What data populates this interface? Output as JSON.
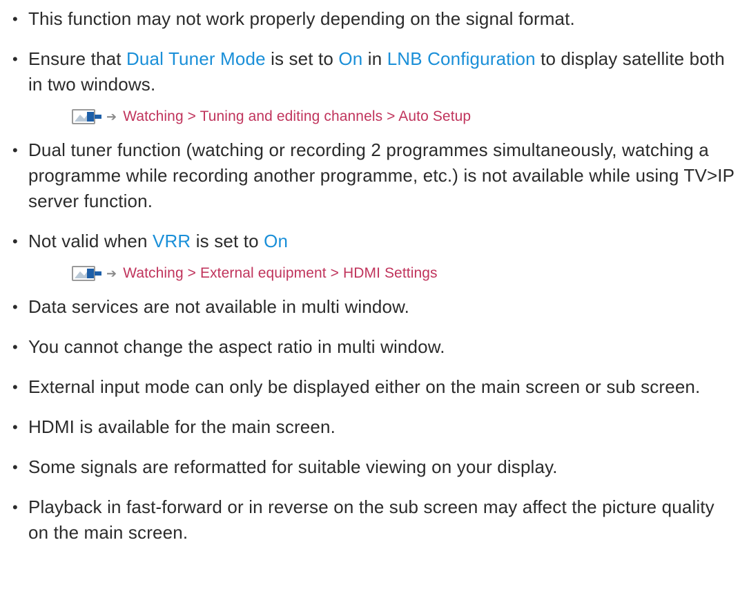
{
  "notes": [
    {
      "text": "This function may not work properly depending on the signal format."
    },
    {
      "parts": [
        "Ensure that ",
        "Dual Tuner Mode",
        " is set to ",
        "On",
        " in ",
        "LNB Configuration",
        " to display satellite both in two windows."
      ]
    },
    {
      "ref": "Watching > Tuning and editing channels > Auto Setup",
      "icon": "tv-screen-icon"
    },
    {
      "text": "Dual tuner function (watching or recording 2 programmes simultaneously, watching a programme while recording another programme, etc.) is not available while using TV>IP server function."
    },
    {
      "parts": [
        "Not valid when ",
        "VRR",
        " is set to ",
        "On"
      ]
    },
    {
      "ref": "Watching > External equipment > HDMI Settings",
      "icon": "tv-screen-icon"
    },
    {
      "text": "Data services are not available in multi window."
    },
    {
      "text": "You cannot change the aspect ratio in multi window."
    },
    {
      "text": "External input mode can only be displayed either on the main screen or sub screen."
    },
    {
      "text": "HDMI is available for the main screen."
    },
    {
      "text": "Some signals are reformatted for suitable viewing on your display."
    },
    {
      "text": "Playback in fast-forward or in reverse on the sub screen may affect the picture quality on the main screen."
    }
  ],
  "bullet_glyph": "•",
  "colors": {
    "body_text": "#2b2b2b",
    "link": "#1a8fd8",
    "reference": "#c0345c",
    "arrow": "#8a8a8a"
  }
}
